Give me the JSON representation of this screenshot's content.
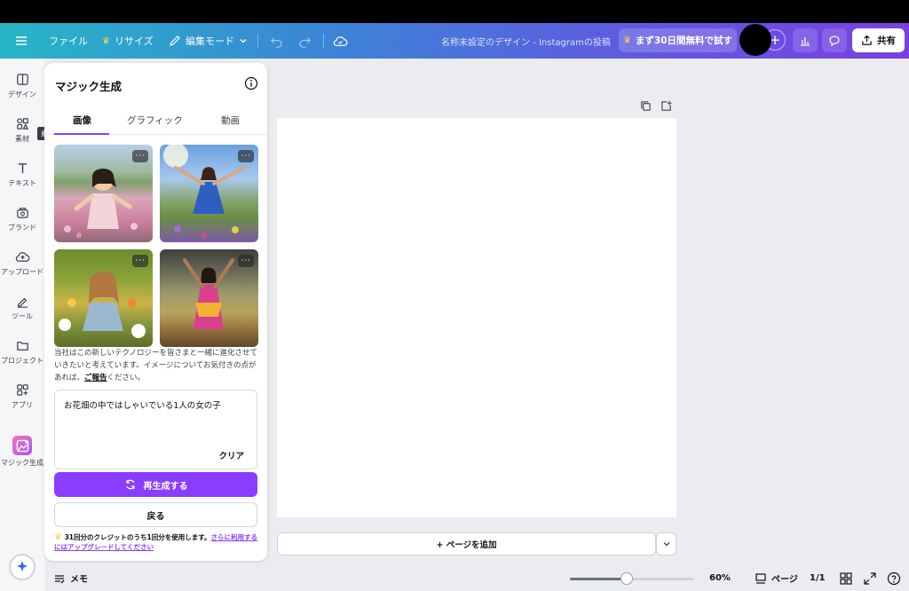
{
  "topbar": {
    "file": "ファイル",
    "resize": "リサイズ",
    "edit_mode": "編集モード",
    "title": "名称未設定のデザイン - Instagramの投稿",
    "trial": "まず30日間無料で試す",
    "share": "共有"
  },
  "rail": {
    "items": [
      {
        "label": "デザイン"
      },
      {
        "label": "素材"
      },
      {
        "label": "テキスト"
      },
      {
        "label": "ブランド"
      },
      {
        "label": "アップロード"
      },
      {
        "label": "ツール"
      },
      {
        "label": "プロジェクト"
      },
      {
        "label": "アプリ"
      },
      {
        "label": "マジック生成"
      }
    ],
    "tooltip": "素材"
  },
  "panel": {
    "title": "マジック生成",
    "tabs": [
      "画像",
      "グラフィック",
      "動画"
    ],
    "active_tab": "画像",
    "notice_pre": "当社はこの新しいテクノロジーを皆さまと一緒に進化させていきたいと考えています。イメージについてお気付きの点があれば、",
    "notice_link": "ご報告",
    "notice_post": "ください。",
    "prompt": "お花畑の中ではしゃいでいる1人の女の子",
    "clear": "クリア",
    "regenerate": "再生成する",
    "back": "戻る",
    "credit_text": "31回分のクレジットのうち1回分を使用します。",
    "credit_link": "さらに利用するにはアップグレードしてください"
  },
  "canvas": {
    "add_page": "+ ページを追加"
  },
  "bottom": {
    "memo": "メモ",
    "zoom": "60%",
    "zoom_fraction": 0.46,
    "pages_label": "ページ",
    "page_count": "1/1"
  },
  "colors": {
    "accent": "#8b3dff",
    "crown": "#ffd34d"
  }
}
